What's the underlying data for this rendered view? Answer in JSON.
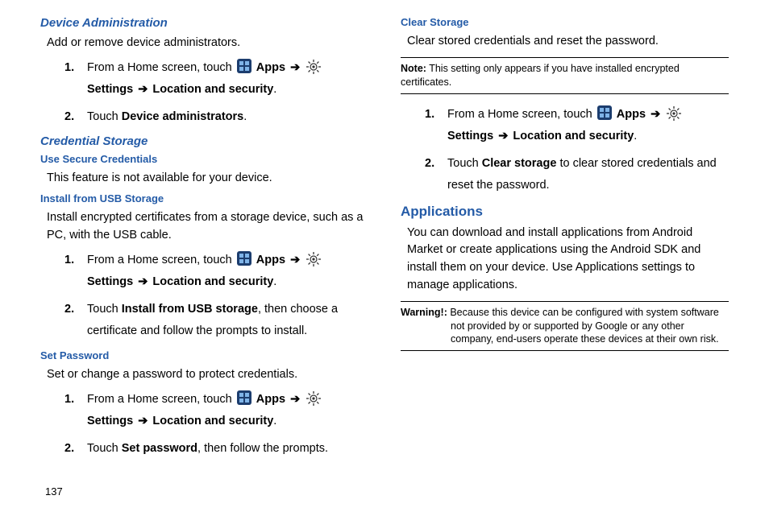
{
  "left": {
    "h1": "Device Administration",
    "p1": "Add or remove device administrators.",
    "step1a_prefix": "From a Home screen, touch ",
    "apps_label": "Apps",
    "settings_label": "Settings",
    "loc_sec": "Location and security",
    "step1b_prefix": "Touch ",
    "step1b_bold": "Device administrators",
    "h2": "Credential Storage",
    "h2a": "Use Secure Credentials",
    "p2": "This feature is not available for your device.",
    "h2b": "Install from USB Storage",
    "p3": "Install encrypted certificates from a storage device, such as a PC, with the USB cable.",
    "step2b_bold": "Install from USB storage",
    "step2b_suffix": ", then choose a certificate and follow the prompts to install.",
    "h2c": "Set Password",
    "p4": "Set or change a password to protect credentials.",
    "step3b_bold": "Set password",
    "step3b_suffix": ", then follow the prompts."
  },
  "right": {
    "h1": "Clear Storage",
    "p1": "Clear stored credentials and reset the password.",
    "note_label": "Note:",
    "note_text": " This setting only appears if you have installed encrypted certificates.",
    "step1a_prefix": "From a Home screen, touch ",
    "step1b_prefix": "Touch ",
    "step1b_bold": "Clear storage",
    "step1b_suffix": " to clear stored credentials and reset the password.",
    "h2": "Applications",
    "p2": "You can download and install applications from Android Market or create applications using the Android SDK and install them on your device. Use Applications settings to manage applications.",
    "warn_label": "Warning!:",
    "warn_text": " Because this device can be configured with system software not provided by or supported by Google or any other company, end-users operate these devices at their own risk."
  },
  "arrow": "➔",
  "page_number": "137"
}
